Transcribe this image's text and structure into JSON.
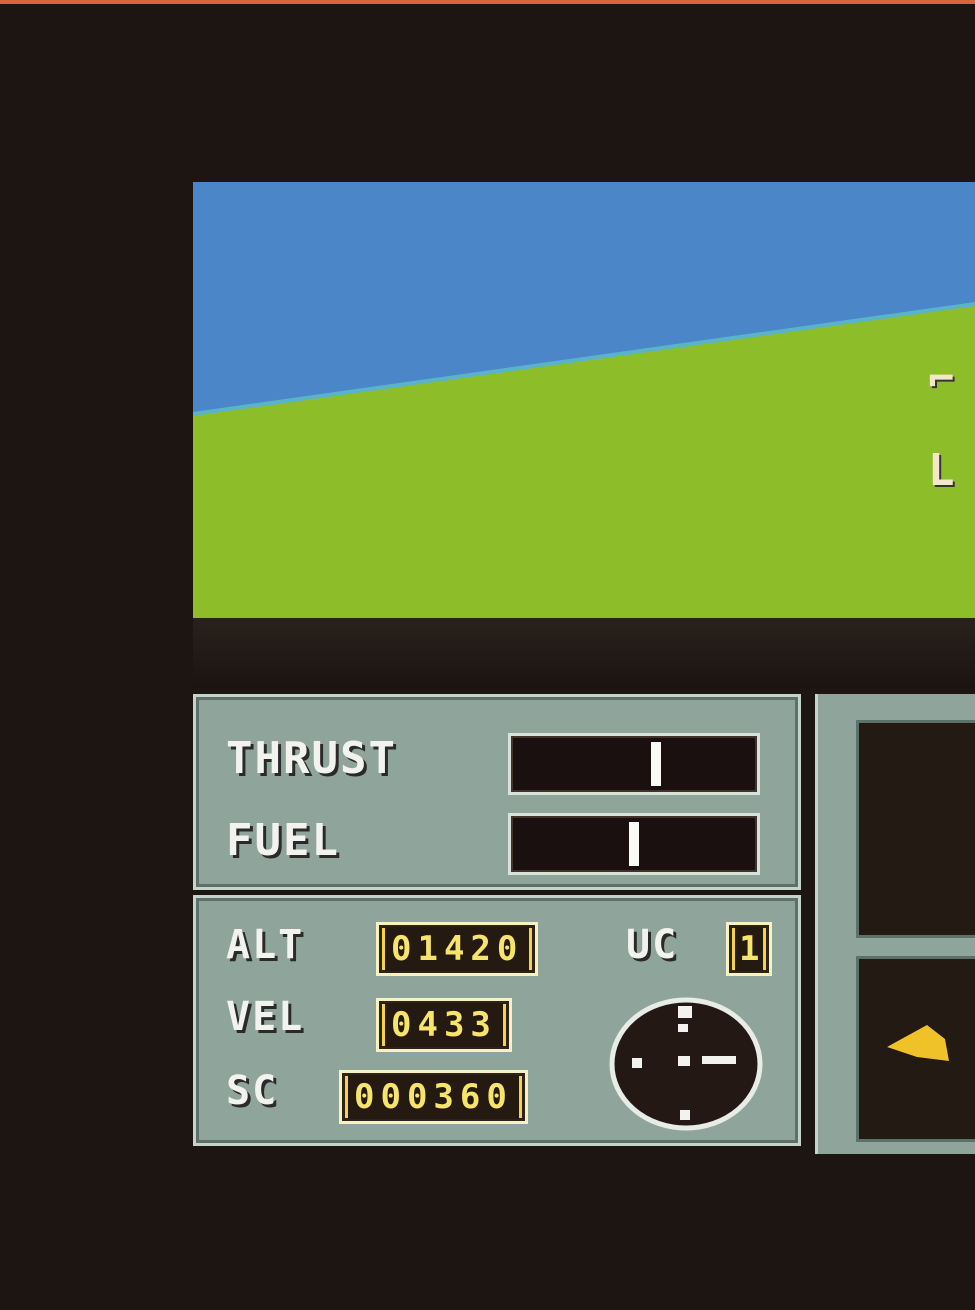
{
  "game": {
    "horizon": {
      "sky_color": "#4a86c8",
      "ground_color": "#8ebd2a",
      "horizon_color": "#5ab4c8"
    },
    "gauges": {
      "thrust": {
        "label": "THRUST",
        "level": 0.62
      },
      "fuel": {
        "label": "FUEL",
        "level": 0.52
      }
    },
    "readouts": {
      "alt": {
        "label": "ALT",
        "value": "01420"
      },
      "vel": {
        "label": "VEL",
        "value": "0433"
      },
      "sc": {
        "label": "SC",
        "value": "000360"
      },
      "uc": {
        "label": "UC",
        "value": "1"
      }
    },
    "view_marks": {
      "top": "⌐",
      "bottom": "L"
    },
    "colors": {
      "panel": "#8fa59c",
      "digit_frame": "#f6d44a",
      "digit_text": "#f7e46a",
      "needle": "#fbfbf5"
    }
  }
}
